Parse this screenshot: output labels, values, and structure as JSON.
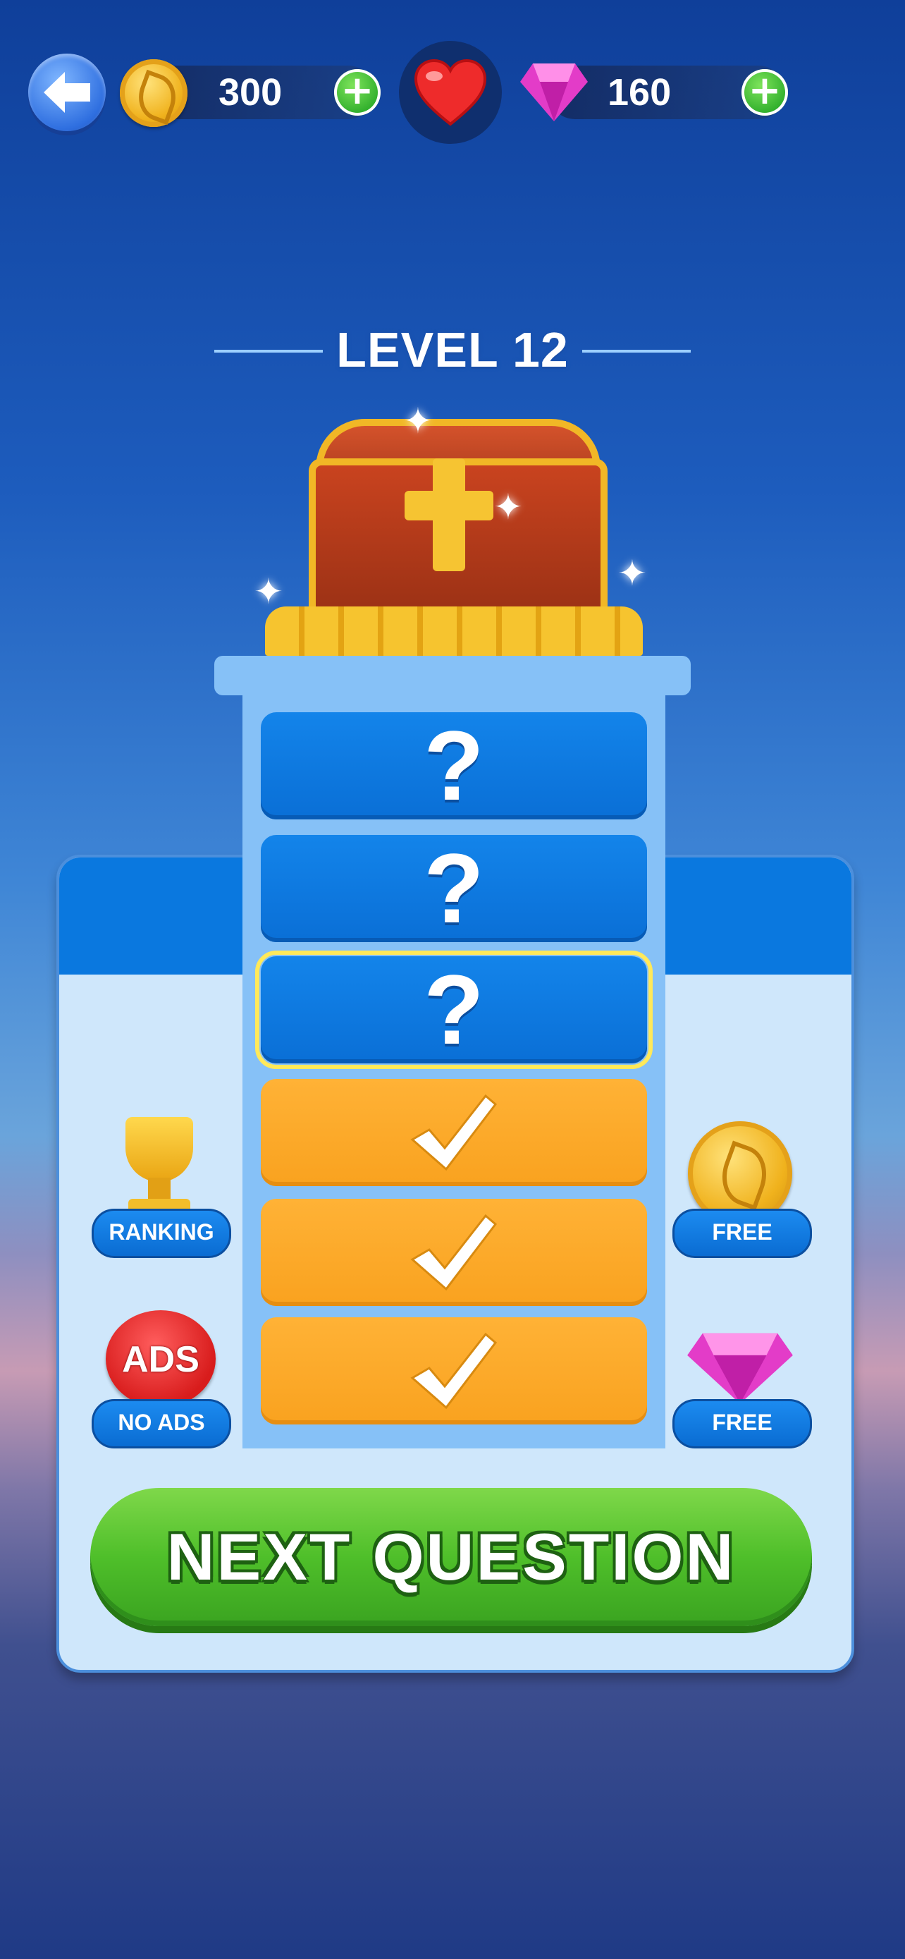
{
  "header": {
    "coins_value": "300",
    "gems_value": "160",
    "icons": [
      "back-arrow-icon",
      "coin-icon",
      "plus-icon",
      "heart-icon",
      "gem-icon",
      "plus-icon"
    ]
  },
  "level": {
    "title": "LEVEL 12"
  },
  "question_slots": [
    {
      "state": "locked",
      "label": "?"
    },
    {
      "state": "locked",
      "label": "?"
    },
    {
      "state": "current",
      "label": "?"
    },
    {
      "state": "completed",
      "label": "✓"
    },
    {
      "state": "completed",
      "label": "✓"
    },
    {
      "state": "completed",
      "label": "✓"
    }
  ],
  "side_left": {
    "ranking_label": "RANKING",
    "no_ads_label": "NO ADS",
    "ads_badge_text": "ADS"
  },
  "side_right": {
    "free_coin_label": "FREE",
    "free_gem_label": "FREE"
  },
  "next_button": {
    "label": "NEXT QUESTION"
  },
  "colors": {
    "accent_blue": "#0a78df",
    "completed_orange": "#f9a21f",
    "current_outline": "#ffe95a",
    "next_green": "#4fbf2a"
  }
}
